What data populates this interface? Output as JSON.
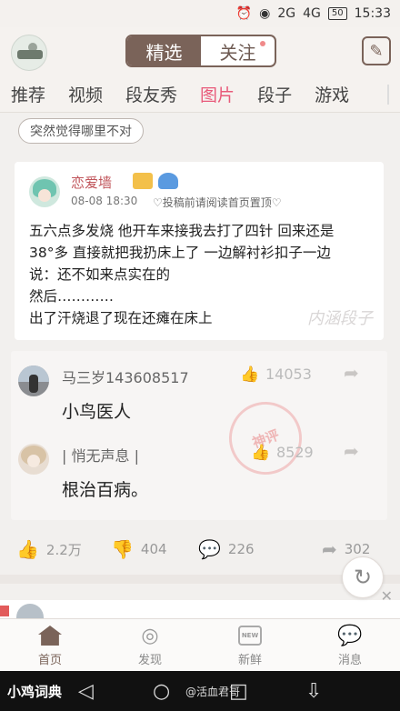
{
  "status": {
    "time": "15:33",
    "network1": "2G",
    "network2": "4G",
    "battery": "50"
  },
  "header": {
    "tabs": [
      "精选",
      "关注"
    ]
  },
  "nav_tabs": [
    "推荐",
    "视频",
    "段友秀",
    "图片",
    "段子",
    "游戏"
  ],
  "topic": "突然觉得哪里不对",
  "post": {
    "author": "恋爱墙",
    "time": "08-08 18:30",
    "tag": "♡投稿前请阅读首页置顶♡",
    "lines": [
      "五六点多发烧 他开车来接我去打了四针 回来还是",
      "38°多 直接就把我扔床上了 一边解衬衫扣子一边",
      "说：还不如来点实在的",
      "然后…………",
      "出了汗烧退了现在还瘫在床上"
    ],
    "watermark": "内涵段子"
  },
  "comments": [
    {
      "user": "马三岁143608517",
      "likes": "14053",
      "text": "小鸟医人"
    },
    {
      "user": "| 悄无声息 |",
      "likes": "8529",
      "text": "根治百病。"
    }
  ],
  "stamp": "神评",
  "actions": {
    "likes": "2.2万",
    "dislikes": "404",
    "comments": "226",
    "shares": "302"
  },
  "bottom_nav": [
    "首页",
    "发现",
    "新鲜",
    "消息"
  ],
  "sysbar": {
    "brand": "小鸡词典",
    "credit": "@活血君哥"
  }
}
